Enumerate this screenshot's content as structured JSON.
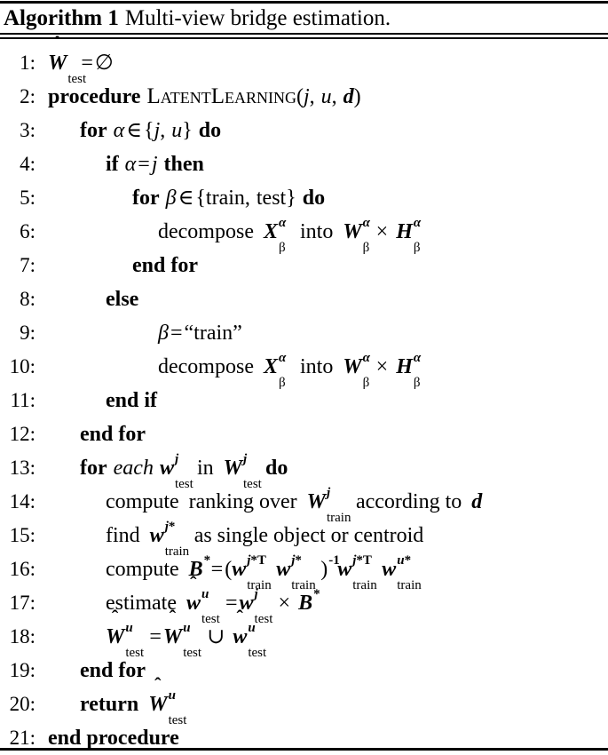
{
  "caption": {
    "label": "Algorithm 1",
    "title": "Multi-view bridge estimation."
  },
  "lines": [
    {
      "n": "1:",
      "indent": 0,
      "text": "Ŵ_test = ∅"
    },
    {
      "n": "2:",
      "indent": 0,
      "text": "procedure LatentLearning(j, u, d)"
    },
    {
      "n": "3:",
      "indent": 1,
      "text": "for α ∈ {j, u} do"
    },
    {
      "n": "4:",
      "indent": 2,
      "text": "if α = j then"
    },
    {
      "n": "5:",
      "indent": 3,
      "text": "for β ∈ {train, test} do"
    },
    {
      "n": "6:",
      "indent": 4,
      "text": "decompose X^α_β into W^α_β × H^α_β"
    },
    {
      "n": "7:",
      "indent": 3,
      "text": "end for"
    },
    {
      "n": "8:",
      "indent": 2,
      "text": "else"
    },
    {
      "n": "9:",
      "indent": 3,
      "text": "β = “train”"
    },
    {
      "n": "10:",
      "indent": 3,
      "text": "decompose X^α_β into W^α_β × H^α_β"
    },
    {
      "n": "11:",
      "indent": 2,
      "text": "end if"
    },
    {
      "n": "12:",
      "indent": 1,
      "text": "end for"
    },
    {
      "n": "13:",
      "indent": 1,
      "text": "for each w^j_test in W^j_test do"
    },
    {
      "n": "14:",
      "indent": 2,
      "text": "compute ranking over W^j_train according to d"
    },
    {
      "n": "15:",
      "indent": 2,
      "text": "find w^j*_train as single object or centroid"
    },
    {
      "n": "16:",
      "indent": 2,
      "text": "compute B* = (w^j*T_train w^j*_train)^-1 w^j*T_train w^u*_train"
    },
    {
      "n": "17:",
      "indent": 2,
      "text": "estimate ŵ^u_test = w^j_test × B*"
    },
    {
      "n": "18:",
      "indent": 2,
      "text": "Ŵ^u_test = Ŵ^u_test ∪ ŵ^u_test"
    },
    {
      "n": "19:",
      "indent": 1,
      "text": "end for"
    },
    {
      "n": "20:",
      "indent": 1,
      "text": "return Ŵ^u_test"
    },
    {
      "n": "21:",
      "indent": 0,
      "text": "end procedure"
    }
  ],
  "tokens": {
    "procedure": "procedure",
    "proc_name": "LatentLearning",
    "for": "for",
    "do": "do",
    "if": "if",
    "then": "then",
    "else": "else",
    "end_for": "end for",
    "end_if": "end if",
    "end_procedure": "end procedure",
    "return": "return",
    "each": "each",
    "in": "in",
    "decompose": "decompose",
    "into": "into",
    "compute": "compute",
    "ranking_over": "ranking over",
    "according_to": "according to",
    "find": "find",
    "as_single_object_or_centroid": "as single object or centroid",
    "estimate": "estimate",
    "train_quoted": "“train”",
    "train": "train",
    "test": "test",
    "empty_set": "∅",
    "equals": "=",
    "times": "×",
    "union": "∪",
    "in_set": "∈",
    "alpha": "α",
    "beta": "β",
    "j": "j",
    "u": "u",
    "d": "d",
    "W": "W",
    "w": "w",
    "X": "X",
    "H": "H",
    "B": "B",
    "star": "*",
    "transpose": "T",
    "minus_one": "-1",
    "hat": "ˆ",
    "lbrace": "{",
    "rbrace": "}",
    "lparen": "(",
    "rparen": ")",
    "comma": ","
  },
  "colors": {
    "text": "#000000",
    "background": "#ffffff",
    "rule": "#000000"
  }
}
